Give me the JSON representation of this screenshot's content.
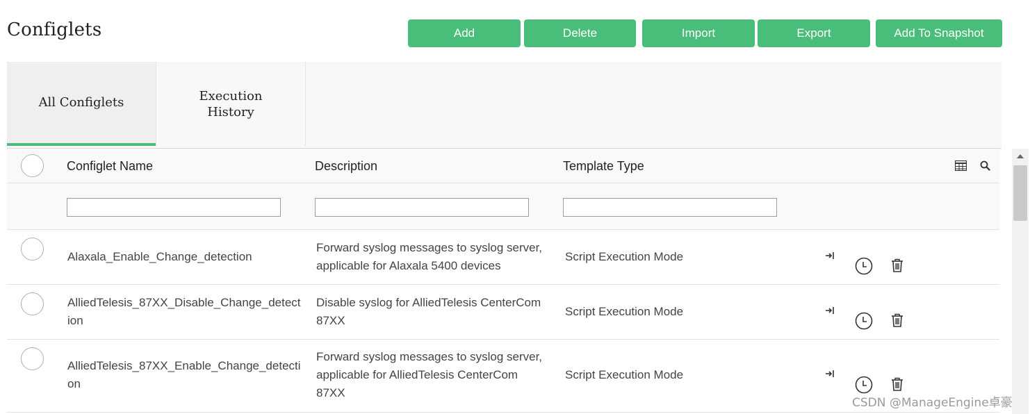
{
  "page": {
    "title": "Configlets"
  },
  "toolbar": {
    "add": "Add",
    "delete": "Delete",
    "import": "Import",
    "export": "Export",
    "add_to_snapshot": "Add To Snapshot"
  },
  "tabs": [
    {
      "label": "All Configlets",
      "active": true
    },
    {
      "label": "Execution\nHistory",
      "active": false
    }
  ],
  "table": {
    "columns": [
      "Configlet Name",
      "Description",
      "Template Type"
    ],
    "header_icons": [
      "table-settings-icon",
      "search-icon"
    ],
    "filters": {
      "name": "",
      "description": "",
      "template_type": ""
    },
    "rows": [
      {
        "name": "Alaxala_Enable_Change_detection",
        "description": "Forward syslog messages to syslog server, applicable for Alaxala 5400 devices",
        "template_type": "Script Execution Mode"
      },
      {
        "name": "AlliedTelesis_87XX_Disable_Change_detection",
        "description": "Disable syslog for AlliedTelesis CenterCom 87XX",
        "template_type": "Script Execution Mode"
      },
      {
        "name": "AlliedTelesis_87XX_Enable_Change_detection",
        "description": "Forward syslog messages to syslog server, applicable for AlliedTelesis CenterCom 87XX",
        "template_type": "Script Execution Mode"
      }
    ],
    "row_actions": [
      "execute-icon",
      "schedule-clock-icon",
      "delete-trash-icon"
    ]
  },
  "watermark": "CSDN @ManageEngine卓豪",
  "colors": {
    "accent": "#49be7a",
    "header_bg": "#f9f9f9",
    "text": "#444444"
  }
}
